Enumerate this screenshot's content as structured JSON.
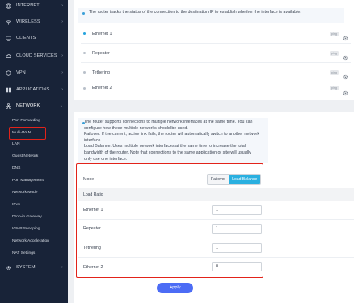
{
  "sidebar": {
    "items": [
      {
        "label": "INTERNET",
        "icon": "globe-icon"
      },
      {
        "label": "WIRELESS",
        "icon": "wifi-icon"
      },
      {
        "label": "CLIENTS",
        "icon": "monitor-icon"
      },
      {
        "label": "CLOUD SERVICES",
        "icon": "cloud-icon"
      },
      {
        "label": "VPN",
        "icon": "shield-icon"
      },
      {
        "label": "APPLICATIONS",
        "icon": "apps-icon"
      },
      {
        "label": "NETWORK",
        "icon": "network-icon"
      },
      {
        "label": "SYSTEM",
        "icon": "gear-icon"
      }
    ],
    "network_sub": [
      "Port Forwarding",
      "Multi-WAN",
      "LAN",
      "Guest Network",
      "DNS",
      "Port Management",
      "Network Mode",
      "IPv6",
      "Drop-in Gateway",
      "IGMP Snooping",
      "Network Acceleration",
      "NAT Settings"
    ]
  },
  "tracking": {
    "info": "The router tracks the status of the connection to the destination IP to establish whether the interface is available.",
    "ports": [
      {
        "name": "Ethernet 1",
        "badge": "ping"
      },
      {
        "name": "Repeater",
        "badge": "ping"
      },
      {
        "name": "Tethering",
        "badge": "ping"
      },
      {
        "name": "Ethernet 2",
        "badge": "ping"
      }
    ]
  },
  "multiwan": {
    "info_lines": [
      "The router supports connections to multiple network interfaces at the same time. You can",
      "configure how these multiple networks should be used.",
      "Failover: If the current, active link fails, the router will automatically switch to another network",
      "interface.",
      "Load Balance: Uses multiple network interfaces at the same time to increase the total",
      "bandwidth of the router. Note that connections to the same application or site will usually",
      "only use one interface."
    ],
    "mode_label": "Mode",
    "mode_options": [
      "Failover",
      "Load Balance"
    ],
    "mode_selected": "Load Balance",
    "ratio_header": "Load Ratio",
    "ratios": [
      {
        "name": "Ethernet 1",
        "value": "1"
      },
      {
        "name": "Repeater",
        "value": "1"
      },
      {
        "name": "Tethering",
        "value": "1"
      },
      {
        "name": "Ethernet 2",
        "value": "0"
      }
    ],
    "apply_label": "Apply"
  },
  "colors": {
    "sidebar_bg": "#182338",
    "accent": "#2ab0e0",
    "apply": "#4c6cf5",
    "highlight": "#e2231a"
  }
}
